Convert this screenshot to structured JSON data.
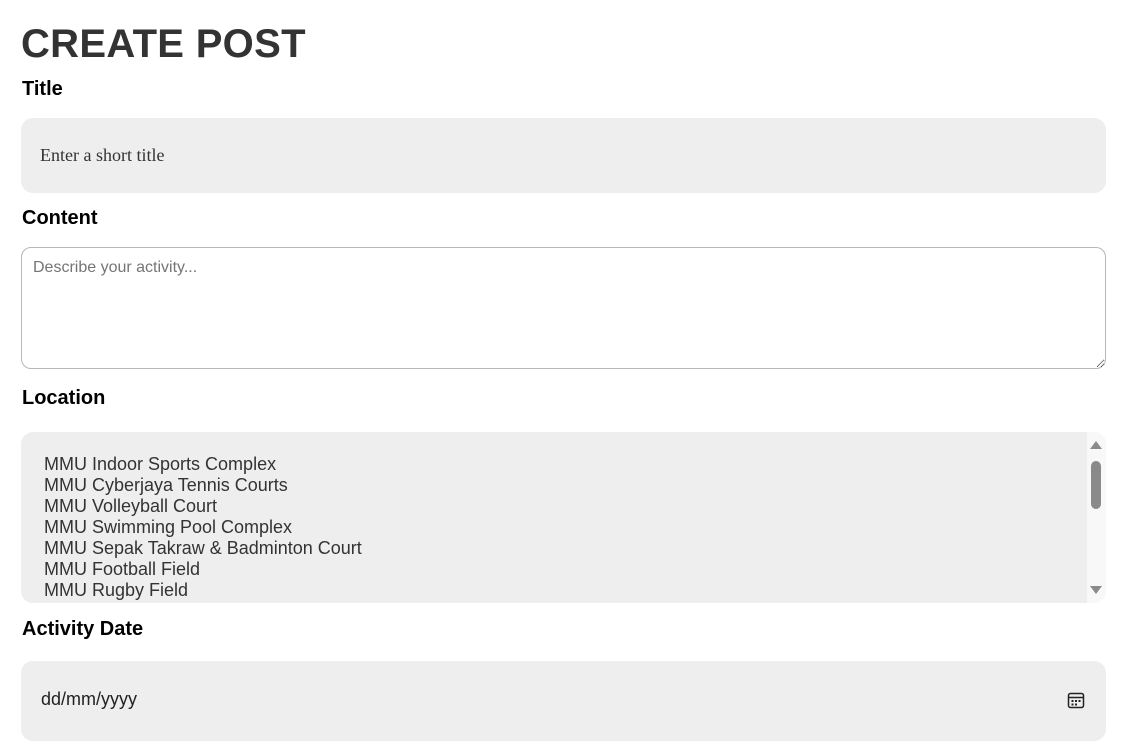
{
  "page": {
    "title": "CREATE POST"
  },
  "form": {
    "title": {
      "label": "Title",
      "placeholder": "Enter a short title",
      "value": ""
    },
    "content": {
      "label": "Content",
      "placeholder": "Describe your activity...",
      "value": ""
    },
    "location": {
      "label": "Location",
      "options": [
        "MMU Indoor Sports Complex",
        "MMU Cyberjaya Tennis Courts",
        "MMU Volleyball Court",
        "MMU Swimming Pool Complex",
        "MMU Sepak Takraw & Badminton Court",
        "MMU Football Field",
        "MMU Rugby Field"
      ]
    },
    "activity_date": {
      "label": "Activity Date",
      "placeholder": "dd/mm/yyyy",
      "icon": "calendar-icon"
    }
  },
  "colors": {
    "field_background": "#eeeeee",
    "heading": "#333333"
  }
}
